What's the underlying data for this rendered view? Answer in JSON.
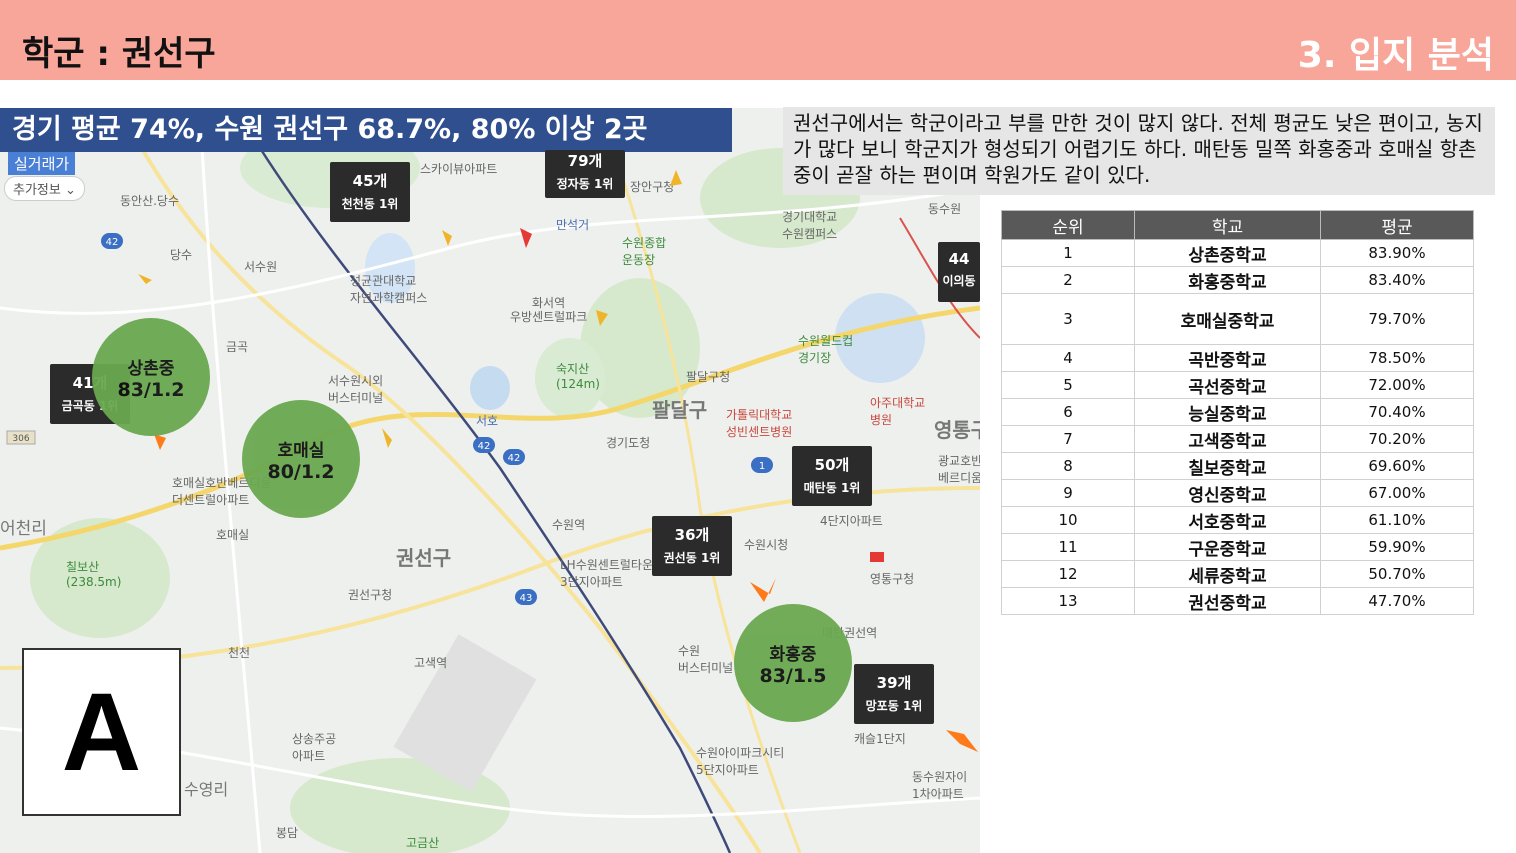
{
  "header": {
    "title": "학군 : 권선구",
    "section": "3. 입지 분석"
  },
  "banner": "경기 평균 74%, 수원 권선구 68.7%, 80% 이상 2곳",
  "map": {
    "chips": {
      "real_trade": "실거래가",
      "extra_info": "추가정보"
    },
    "labels": {
      "dongansan": "동안산.당수",
      "dangsu": "당수",
      "seosuwon": "서수원",
      "seokyungdae": "성균관대학교\n자연과학캠퍼스",
      "hwaseo_station": "화서역",
      "woobang": "우방센트럴파크",
      "manseok": "만석거",
      "suwon_sports": "수원종합\n운동장",
      "jangan": "장안구청",
      "kyonggi_univ": "경기대학교\n수원캠퍼스",
      "dongsuwon": "동수원",
      "seosuwon_terminal": "서수원시외\n버스터미널",
      "sukjisan": "숙지산\n(124m)",
      "seoho": "서호",
      "gyeonggi_office": "경기도청",
      "paldal_office": "팔달구청",
      "paldal": "팔달구",
      "catholic": "가톨릭대학교\n성빈센트병원",
      "world_cup": "수원월드컵\n경기장",
      "ajou": "아주대학교\n병원",
      "yeongtong": "영통구",
      "geumgok": "금곡",
      "homaesil_apt": "호매실호반베르디움\n더센트럴아파트",
      "homaesil": "호매실",
      "eocheonri": "어천리",
      "chilbosan": "칠보산\n(238.5m)",
      "gwonseon": "권선구",
      "gwonseon_office": "권선구청",
      "suwon_station": "수원역",
      "lh_apt": "LH수원센트럴타운\n3단지아파트",
      "suwon_cityhall": "수원시청",
      "yeongtong_office": "영통구청",
      "maetan_apt": "4단지아파트",
      "gwanggyo_apt": "광교호반\n베르디움",
      "cheoncheon": "천천",
      "gosaek": "고색역",
      "sangsu": "상송주공\n아파트",
      "suwon_terminal": "수원\n버스터미널",
      "iapark": "수원아이파크시티\n5단지아파트",
      "maetan_gwonseon": "매탄권선역",
      "castle": "캐슬1단지",
      "dongsuwon_apt": "동수원자이\n1차아파트",
      "suyeongri": "수영리",
      "bongdam": "봉담",
      "gorgeon": "고금산",
      "sky_apt": "스카이뷰아파트",
      "jeongja": "정자동",
      "uimodel": "이의동"
    },
    "rank_boxes": [
      {
        "count": "45개",
        "area": "천천동 1위"
      },
      {
        "count": "79개",
        "area": "정자동 1위"
      },
      {
        "count": "44",
        "area": "이의동"
      },
      {
        "count": "41개",
        "area": "금곡동 1위"
      },
      {
        "count": "50개",
        "area": "매탄동 1위"
      },
      {
        "count": "36개",
        "area": "권선동 1위"
      },
      {
        "count": "39개",
        "area": "망포동 1위"
      }
    ],
    "circles": [
      {
        "name": "상촌중",
        "score": "83/1.2"
      },
      {
        "name": "호매실",
        "score": "80/1.2"
      },
      {
        "name": "화홍중",
        "score": "83/1.5"
      }
    ],
    "highway_numbers": [
      "42",
      "42",
      "42",
      "43",
      "1",
      "306"
    ],
    "a_marker": "A"
  },
  "description": "권선구에서는 학군이라고 부를 만한 것이 많지 않다. 전체 평균도 낮은 편이고, 농지가 많다 보니 학군지가 형성되기 어렵기도 하다. 매탄동 밀쪽 화홍중과 호매실 항촌중이 곧잘 하는 편이며 학원가도 같이 있다.",
  "table": {
    "headers": [
      "순위",
      "학교",
      "평균"
    ],
    "rows": [
      {
        "rank": "1",
        "school": "상촌중학교",
        "avg": "83.90%"
      },
      {
        "rank": "2",
        "school": "화홍중학교",
        "avg": "83.40%"
      },
      {
        "rank": "3",
        "school": "호매실중학교",
        "avg": "79.70%"
      },
      {
        "rank": "4",
        "school": "곡반중학교",
        "avg": "78.50%"
      },
      {
        "rank": "5",
        "school": "곡선중학교",
        "avg": "72.00%"
      },
      {
        "rank": "6",
        "school": "능실중학교",
        "avg": "70.40%"
      },
      {
        "rank": "7",
        "school": "고색중학교",
        "avg": "70.20%"
      },
      {
        "rank": "8",
        "school": "칠보중학교",
        "avg": "69.60%"
      },
      {
        "rank": "9",
        "school": "영신중학교",
        "avg": "67.00%"
      },
      {
        "rank": "10",
        "school": "서호중학교",
        "avg": "61.10%"
      },
      {
        "rank": "11",
        "school": "구운중학교",
        "avg": "59.90%"
      },
      {
        "rank": "12",
        "school": "세류중학교",
        "avg": "50.70%"
      },
      {
        "rank": "13",
        "school": "권선중학교",
        "avg": "47.70%"
      }
    ]
  },
  "colors": {
    "header_bg": "#f8a59a",
    "banner_bg": "#2f4f8f",
    "circle_green": "#6aa84f",
    "table_header": "#595959"
  }
}
